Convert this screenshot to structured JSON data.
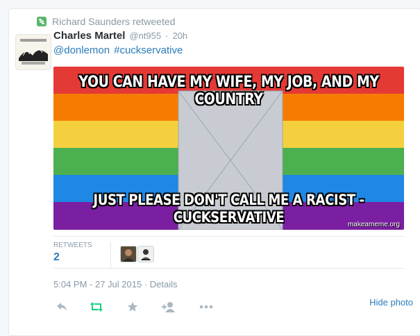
{
  "retweet_context": {
    "text": "Richard Saunders retweeted"
  },
  "tweet": {
    "display_name": "Charles Martel",
    "handle": "@nt955",
    "separator": "·",
    "time_ago": "20h",
    "mentions": [
      "@donlemon",
      "#cuckservative"
    ]
  },
  "media": {
    "top_caption": "YOU CAN HAVE MY WIFE, MY JOB, AND MY COUNTRY",
    "bottom_caption_line1": "JUST PLEASE DON'T CALL ME A RACIST -",
    "bottom_caption_line2": "CUCKSERVATIVE",
    "watermark": "makeameme.org",
    "rainbow_colors": [
      "#e53935",
      "#f57c00",
      "#f4d03f",
      "#4caf50",
      "#1e88e5",
      "#7b1fa2"
    ]
  },
  "stats": {
    "retweets_label": "RETWEETS",
    "retweets_count": "2"
  },
  "details": {
    "timestamp": "5:04 PM - 27 Jul 2015",
    "separator": "·",
    "details_label": "Details"
  },
  "actions": {
    "icons": [
      "reply-icon",
      "retweet-icon",
      "favorite-icon",
      "follow-icon",
      "more-icon"
    ],
    "hide_photo_label": "Hide photo"
  },
  "colors": {
    "link": "#2b7bb9",
    "muted": "#8899a6",
    "retweet_green": "#19cf86"
  }
}
